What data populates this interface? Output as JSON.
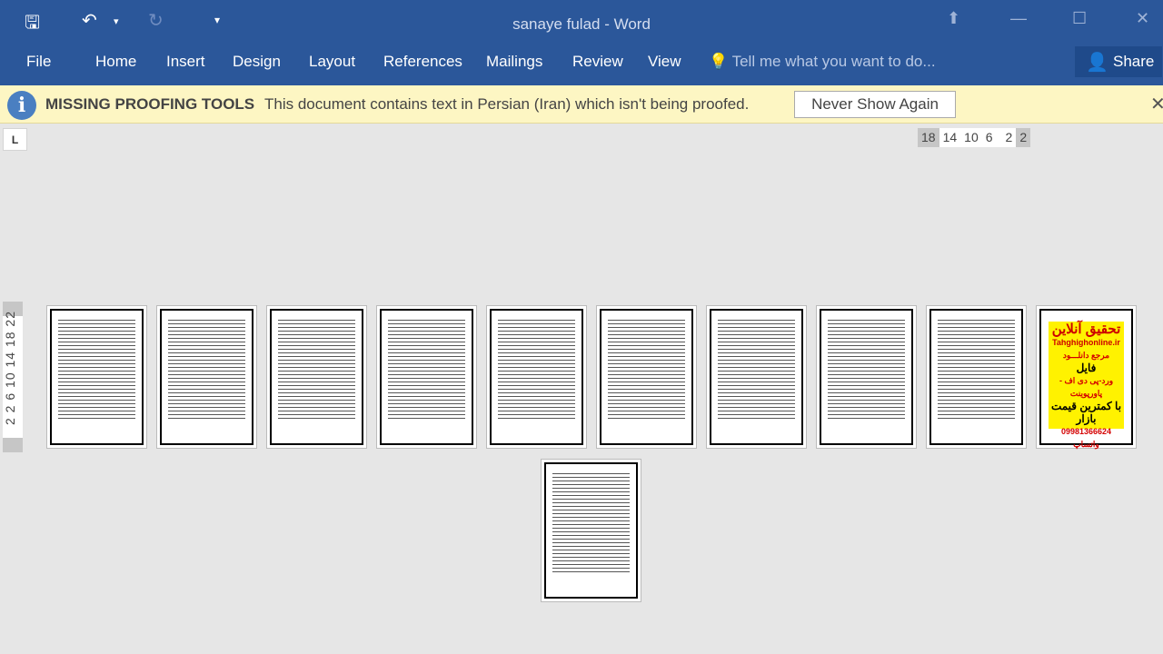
{
  "app": {
    "title": "sanaye fulad - Word"
  },
  "qat": {
    "save": "save-icon",
    "undo": "undo-icon",
    "redo": "redo-icon",
    "customize": "customize-icon"
  },
  "ribbon": {
    "tabs": [
      "File",
      "Home",
      "Insert",
      "Design",
      "Layout",
      "References",
      "Mailings",
      "Review",
      "View"
    ],
    "tell_me": "Tell me what you want to do...",
    "share": "Share"
  },
  "colors": {
    "ribbon": "#2b579a",
    "message_bar": "#fdf6c3"
  },
  "message": {
    "title": "MISSING PROOFING TOOLS",
    "text": "This document contains text in Persian (Iran) which isn't being proofed.",
    "button": "Never Show Again"
  },
  "ruler": {
    "tab_selector": "L",
    "horizontal": [
      "18",
      "14",
      "10",
      "6",
      "2",
      "2"
    ],
    "vertical": "2 2 6 10 14 18 22"
  },
  "pages": {
    "count": 11,
    "ad": {
      "title": "تحقیق آنلاین",
      "site": "Tahghighonline.ir",
      "line1": "مرجع دانلـــود",
      "line2": "فایل",
      "line3": "ورد-پی دی اف - پاورپوینت",
      "line4": "با کمترین قیمت بازار",
      "phone": "09981366624 واتساپ"
    }
  }
}
